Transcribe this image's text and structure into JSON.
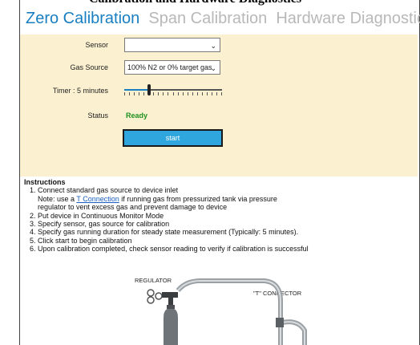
{
  "window_title": "Calibration and Hardware Diagnostics",
  "tabs": [
    {
      "label": "Zero Calibration"
    },
    {
      "label": "Span Calibration"
    },
    {
      "label": "Hardware Diagnostics"
    }
  ],
  "form": {
    "sensor_label": "Sensor",
    "sensor_value": "",
    "gas_source_label": "Gas Source",
    "gas_source_value": "100% N2 or 0% target gas",
    "timer_label": "Timer : 5 minutes",
    "timer_fraction": 0.25,
    "status_label": "Status",
    "status_value": "Ready",
    "start_label": "start"
  },
  "instructions": {
    "title": "Instructions",
    "step1": "1. Connect standard gas source to device inlet",
    "note_prefix": "Note: use a ",
    "note_link": "T Connection",
    "note_suffix": " if running gas from pressurized tank via pressure",
    "note_line2": "regulator to vent excess gas and prevent damage to device",
    "step2": "2. Put device in Continuous Monitor Mode",
    "step3": "3. Specify sensor, gas source for calibration",
    "step4": "4. Specify gas running duration for steady state measurement (Typically: 5 minutes).",
    "step5": "5. Click start to begin calibration",
    "step6": "6. Upon calibration completed, check sensor reading to verify if calibration is successful"
  },
  "diagram": {
    "regulator_label": "REGULATOR",
    "connector_label": "\"T\" CONNECTOR"
  },
  "colors": {
    "accent": "#1a7fc1",
    "panel": "#fbf1d0",
    "status": "#1f8f1f",
    "button": "#2fa6de"
  }
}
